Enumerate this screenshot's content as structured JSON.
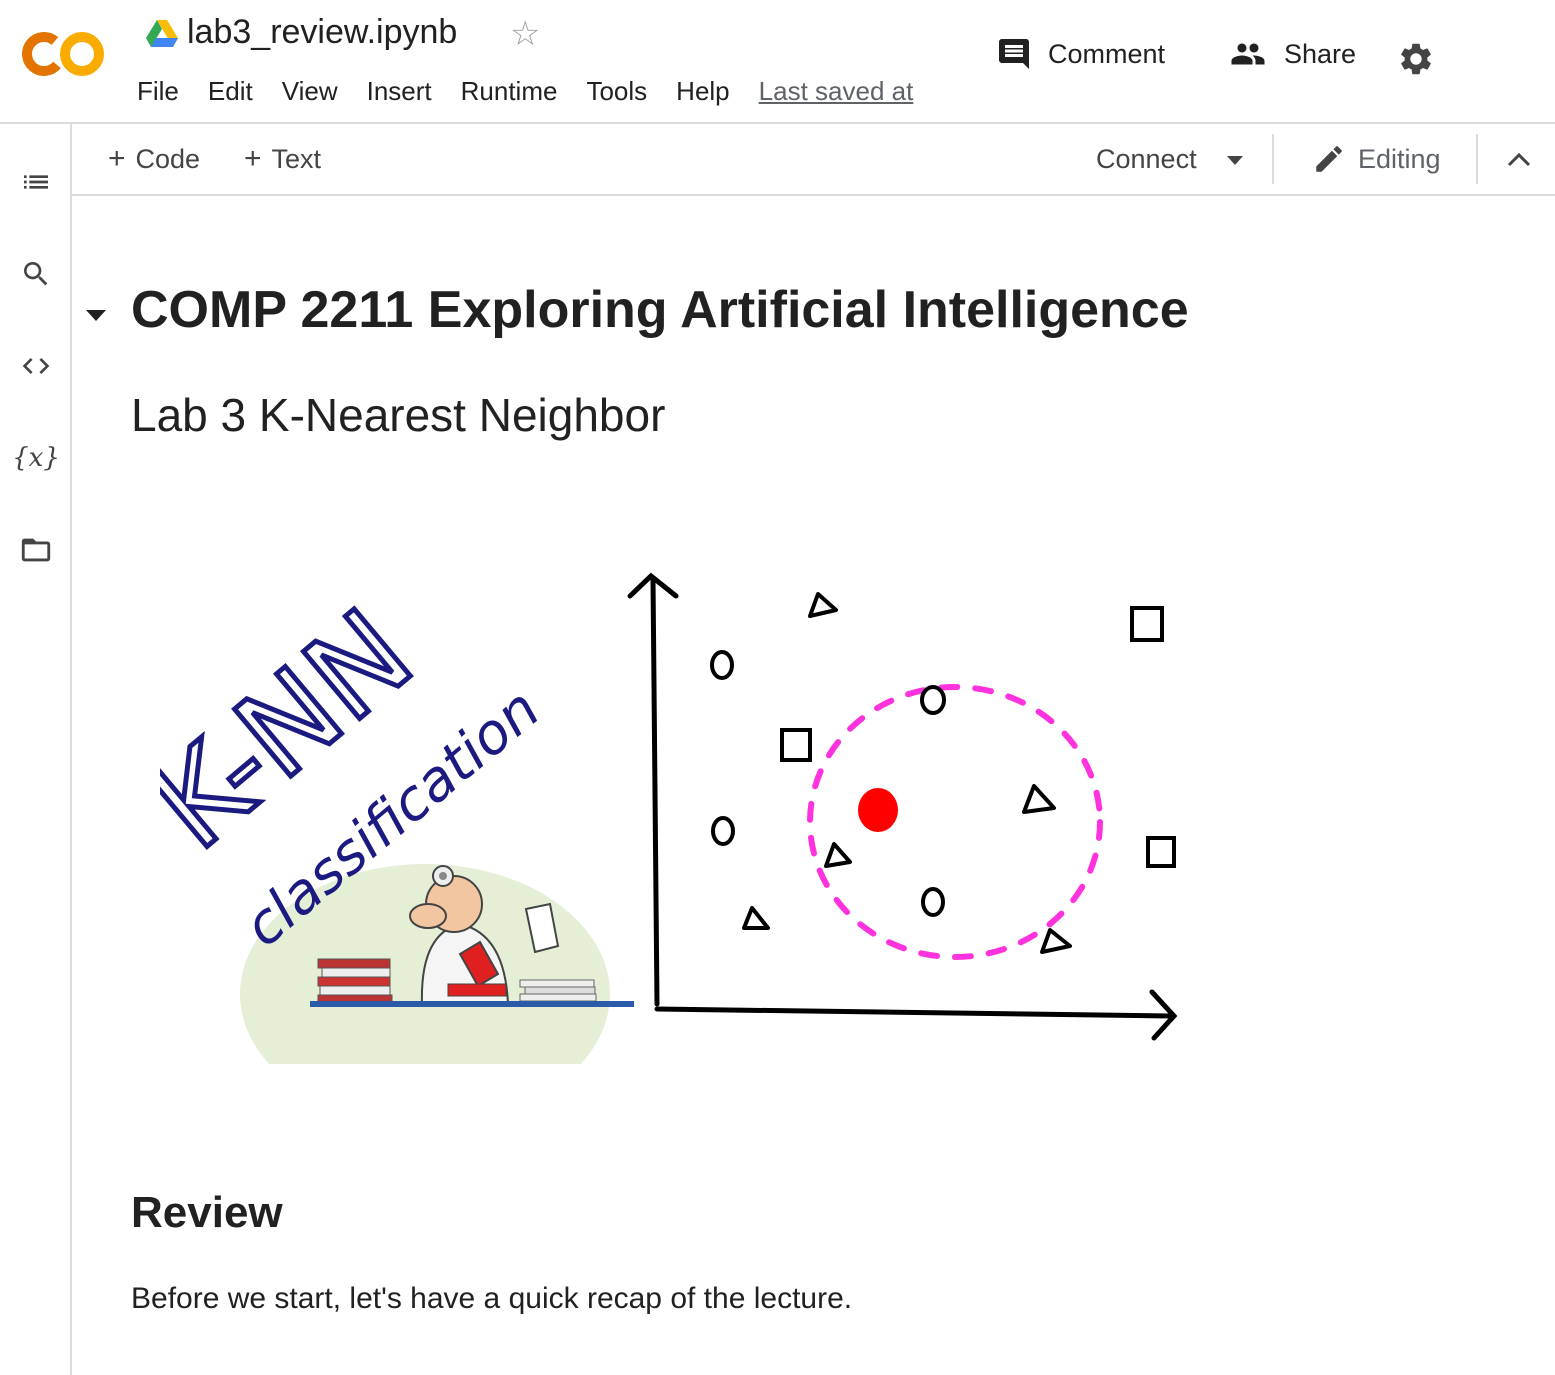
{
  "header": {
    "title": "lab3_review.ipynb",
    "menu": [
      "File",
      "Edit",
      "View",
      "Insert",
      "Runtime",
      "Tools",
      "Help"
    ],
    "last_saved": "Last saved at",
    "comment_label": "Comment",
    "share_label": "Share",
    "icons": {
      "logo": "colab-logo-icon",
      "drive": "google-drive-icon",
      "star": "star-icon",
      "comment": "comment-icon",
      "share": "people-icon",
      "settings": "gear-icon"
    }
  },
  "sidebar": {
    "items": [
      {
        "name": "table-of-contents",
        "icon": "list-icon"
      },
      {
        "name": "find-replace",
        "icon": "search-icon"
      },
      {
        "name": "code-snippets",
        "icon": "code-icon"
      },
      {
        "name": "variables",
        "icon": "variables-icon",
        "label": "{x}"
      },
      {
        "name": "files",
        "icon": "folder-icon"
      }
    ]
  },
  "toolbar": {
    "code_label": "Code",
    "text_label": "Text",
    "connect_label": "Connect",
    "editing_label": "Editing"
  },
  "notebook": {
    "heading": "COMP 2211 Exploring Artificial Intelligence",
    "subheading": "Lab 3 K-Nearest Neighbor",
    "figure": {
      "title_text": "K-NN",
      "subtitle_text": "classification"
    },
    "review_heading": "Review",
    "review_text": "Before we start, let's have a quick recap of the lecture."
  },
  "colors": {
    "logo_orange": "#f9ab00",
    "logo_dark_orange": "#e37400",
    "figure_ink": "#1a1a80",
    "figure_circle": "#ff33dd",
    "query_point": "#ff0000",
    "desk_blue": "#2a5aa8"
  }
}
